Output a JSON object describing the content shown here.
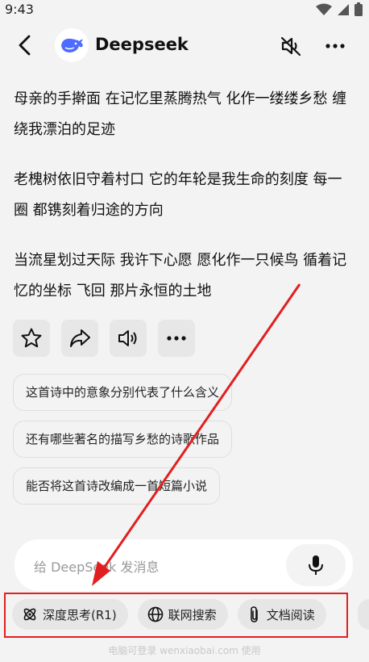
{
  "status": {
    "time": "9:43"
  },
  "header": {
    "title": "Deepseek"
  },
  "message": {
    "paragraphs": [
      "母亲的手擀面 在记忆里蒸腾热气 化作一缕缕乡愁 缠绕我漂泊的足迹",
      "老槐树依旧守着村口 它的年轮是我生命的刻度 每一圈 都镌刻着归途的方向",
      "当流星划过天际 我许下心愿 愿化作一只候鸟 循着记忆的坐标 飞回 那片永恒的土地"
    ]
  },
  "suggestions": [
    "这首诗中的意象分别代表了什么含义",
    "还有哪些著名的描写乡愁的诗歌作品",
    "能否将这首诗改编成一首短篇小说"
  ],
  "input": {
    "placeholder": "给 DeepSeek 发消息"
  },
  "tools": {
    "deep_think": "深度思考(R1)",
    "web_search": "联网搜索",
    "doc_read": "文档阅读"
  },
  "footer": {
    "note": "电脑可登录 wenxiaobai.com 使用"
  },
  "colors": {
    "annotation": "#e02020",
    "background": "#f3f3f3",
    "brand_blue": "#4d6bfe"
  },
  "icons": [
    "back-icon",
    "deepseek-whale-icon",
    "speaker-mute-icon",
    "more-icon",
    "star-icon",
    "share-icon",
    "speaker-icon",
    "mic-icon",
    "atom-icon",
    "globe-icon",
    "paperclip-icon"
  ]
}
